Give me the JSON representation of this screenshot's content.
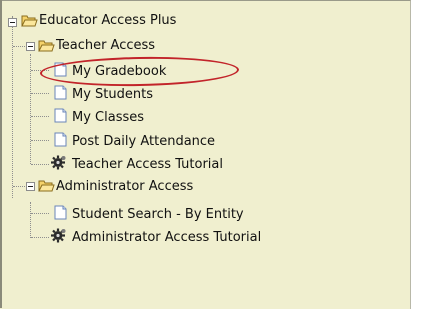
{
  "tree": {
    "root": {
      "label": "Educator Access Plus",
      "icon": "folder-open-icon",
      "expanded": true
    },
    "groups": [
      {
        "label": "Teacher Access",
        "icon": "folder-open-icon",
        "expanded": true,
        "items": [
          {
            "label": "My Gradebook",
            "icon": "document-icon",
            "highlighted": true
          },
          {
            "label": "My Students",
            "icon": "document-icon"
          },
          {
            "label": "My Classes",
            "icon": "document-icon"
          },
          {
            "label": "Post Daily Attendance",
            "icon": "document-icon"
          },
          {
            "label": "Teacher Access Tutorial",
            "icon": "tutorial-gear-icon"
          }
        ]
      },
      {
        "label": "Administrator Access",
        "icon": "folder-open-icon",
        "expanded": true,
        "items": [
          {
            "label": "Student Search - By Entity",
            "icon": "document-icon"
          },
          {
            "label": "Administrator Access Tutorial",
            "icon": "tutorial-gear-icon"
          }
        ]
      }
    ]
  },
  "colors": {
    "panel_background": "#f0efcf",
    "highlight_ellipse": "#c2242a",
    "folder_fill": "#f5d36a"
  }
}
